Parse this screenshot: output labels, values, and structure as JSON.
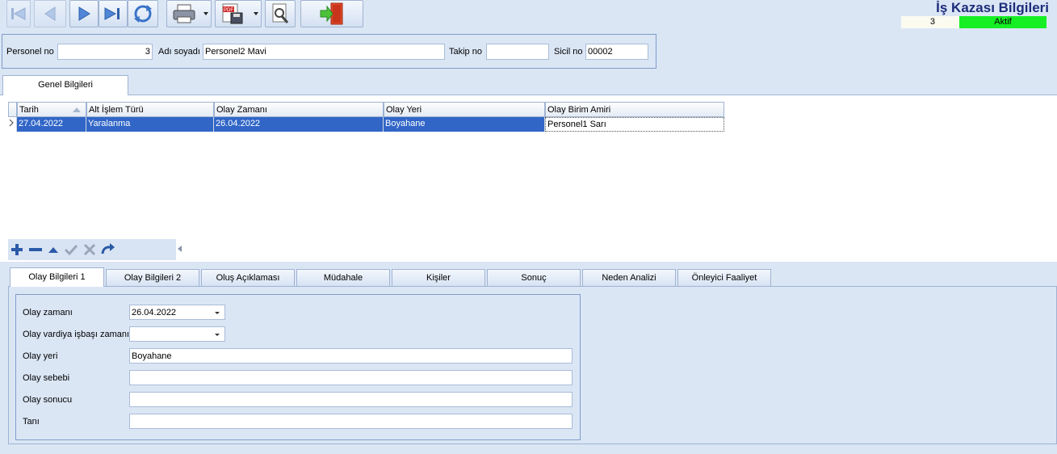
{
  "toolbar": {
    "buttons": [
      "first-icon",
      "prev-icon",
      "next-icon",
      "last-icon",
      "refresh-icon",
      "print-icon",
      "pdf-export-icon",
      "preview-icon",
      "exit-icon"
    ]
  },
  "page_title": "İş Kazası Bilgileri",
  "record_count": "3",
  "status": "Aktif",
  "header": {
    "personel_no_label": "Personel no",
    "personel_no_value": "3",
    "adi_soyadi_label": "Adı soyadı",
    "adi_soyadi_value": "Personel2 Mavi",
    "takip_no_label": "Takip no",
    "takip_no_value": "",
    "sicil_no_label": "Sicil no",
    "sicil_no_value": "00002"
  },
  "top_tab": "Genel Bilgileri",
  "grid": {
    "columns": [
      "Tarih",
      "Alt İşlem Türü",
      "Olay Zamanı",
      "Olay Yeri",
      "Olay Birim Amiri"
    ],
    "rows": [
      [
        "27.04.2022",
        "Yaralanma",
        "26.04.2022",
        "Boyahane",
        "Personel1 Sarı"
      ]
    ]
  },
  "detail_tabs": [
    "Olay Bilgileri 1",
    "Olay Bilgileri 2",
    "Oluş Açıklaması",
    "Müdahale",
    "Kişiler",
    "Sonuç",
    "Neden Analizi",
    "Önleyici Faaliyet"
  ],
  "detail": {
    "olay_zamani_label": "Olay zamanı",
    "olay_zamani_value": "26.04.2022",
    "vardiya_label": "Olay vardiya işbaşı zamanı",
    "vardiya_value": "",
    "olay_yeri_label": "Olay yeri",
    "olay_yeri_value": "Boyahane",
    "olay_sebebi_label": "Olay sebebi",
    "olay_sebebi_value": "",
    "olay_sonucu_label": "Olay sonucu",
    "olay_sonucu_value": "",
    "tani_label": "Tanı",
    "tani_value": ""
  },
  "colors": {
    "background": "#dbe6f5",
    "status_green": "#16ef24",
    "selection_blue": "#3166c7",
    "title_blue": "#1d2d7a"
  }
}
